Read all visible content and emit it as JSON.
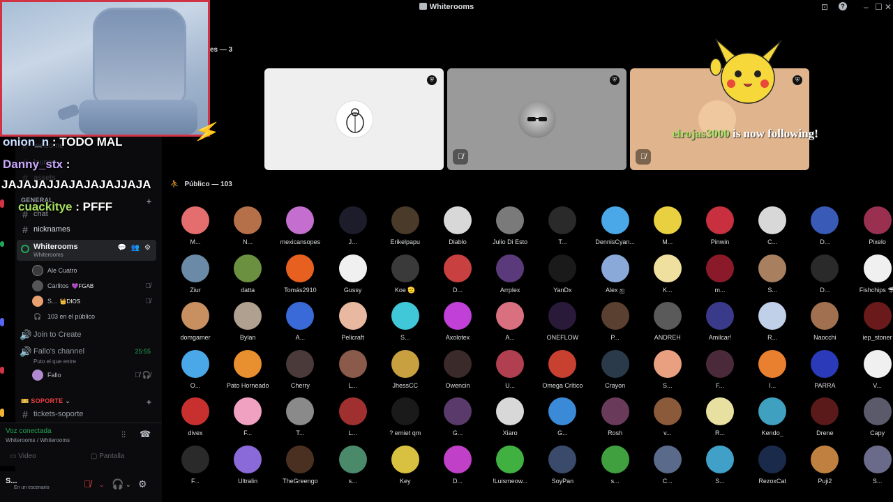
{
  "window": {
    "title": "Whiterooms",
    "controls": [
      "⊡",
      "?",
      "–",
      "☐",
      "✕"
    ]
  },
  "stream": {
    "chat": [
      {
        "user": "onion_n",
        "sep": " : ",
        "text": "TODO MAL"
      },
      {
        "user": "Danny_stx",
        "sep": " :",
        "text": ""
      },
      {
        "user": "",
        "sep": "",
        "text": "JAJAJAJJAJAJAJAJJAJA"
      },
      {
        "user": "cuackitye",
        "sep": " : ",
        "text": "PFFF"
      }
    ],
    "follow_alert": {
      "name": "elrojas3000",
      "text": " is now following!"
    }
  },
  "sidebar": {
    "faded_rows": [
      "welcome",
      "lounge",
      "assets"
    ],
    "category_general": "GENERAL",
    "chat_channel": "chat",
    "nicknames_channel": "nicknames",
    "voice_channel": {
      "name": "Whiterooms",
      "subtitle": "Whiterooms",
      "icons": "💬 👥 ⚙",
      "members": [
        {
          "name": "Ale Cuatro",
          "badge": "",
          "muted": false,
          "color": "#3a3a3a"
        },
        {
          "name": "Carlitos",
          "badge": "💜FGAB",
          "muted": true,
          "color": "#555"
        },
        {
          "name": "S...",
          "badge": "👑DIOS",
          "muted": true,
          "color": "#e8a070"
        }
      ],
      "audience_count": "103 en el público"
    },
    "join_to_create": "Join to Create",
    "fallo_channel": {
      "name": "Fallo's channel",
      "subtitle": "Puto el que entre",
      "timer": "25:55",
      "member": "Fallo"
    },
    "category_soporte": "🎫 SOPORTE",
    "tickets_channel": "tickets-soporte"
  },
  "voice_panel": {
    "status": "Voz conectada",
    "location": "Whiterooms / Whiterooms",
    "video_label": "Video",
    "screen_label": "Pantalla"
  },
  "user_panel": {
    "name": "S...",
    "status": "En un escenario"
  },
  "stage": {
    "speakers_label": "es — 3",
    "audience_label": "Público — 103",
    "speakers": [
      {
        "bg": "#efefef",
        "avatar": "#ffffff",
        "muted": false
      },
      {
        "bg": "#9a9a9a",
        "avatar": "#6e6e6e",
        "muted": true
      },
      {
        "bg": "#e0b48c",
        "avatar": "#f0c8a0",
        "muted": true
      }
    ]
  },
  "audience": [
    {
      "name": "M...",
      "color": "#e46d6d"
    },
    {
      "name": "N...",
      "color": "#b5704a"
    },
    {
      "name": "mexicansopes",
      "color": "#c46fd0"
    },
    {
      "name": "J...",
      "color": "#1c1c2a"
    },
    {
      "name": "Erikelpapu",
      "color": "#4a3a2a"
    },
    {
      "name": "Diablo",
      "color": "#d8d8d8"
    },
    {
      "name": "Julio Di Esto",
      "color": "#7a7a7a"
    },
    {
      "name": "T...",
      "color": "#2a2a2a"
    },
    {
      "name": "DennisCyan...",
      "color": "#4aa8e8"
    },
    {
      "name": "M...",
      "color": "#e8d040"
    },
    {
      "name": "Pinwin",
      "color": "#c83040"
    },
    {
      "name": "C...",
      "color": "#d8d8d8"
    },
    {
      "name": "D...",
      "color": "#3a5ab8"
    },
    {
      "name": "Pixelo",
      "color": "#9a3050"
    },
    {
      "name": "Ziur",
      "color": "#6a8aa8"
    },
    {
      "name": "datta",
      "color": "#6a9040"
    },
    {
      "name": "Tomás2910",
      "color": "#e86020"
    },
    {
      "name": "Gussy",
      "color": "#f0f0f0"
    },
    {
      "name": "Koe 🫡",
      "color": "#3a3a3a"
    },
    {
      "name": "D...",
      "color": "#c84040"
    },
    {
      "name": "Arrplex",
      "color": "#5a3a7a"
    },
    {
      "name": "YanDx",
      "color": "#1a1a1a"
    },
    {
      "name": "Alex ஐ",
      "color": "#8aa8d8"
    },
    {
      "name": "K...",
      "color": "#f0e0a0"
    },
    {
      "name": "m...",
      "color": "#8a1a2a"
    },
    {
      "name": "S...",
      "color": "#a88060"
    },
    {
      "name": "D...",
      "color": "#2a2a2a"
    },
    {
      "name": "Fishchips 🦈",
      "color": "#f0f0f0"
    },
    {
      "name": "domgamer",
      "color": "#c89060"
    },
    {
      "name": "Bylan",
      "color": "#b0a090"
    },
    {
      "name": "A...",
      "color": "#3a6ad8"
    },
    {
      "name": "Pelicraft",
      "color": "#e8b8a0"
    },
    {
      "name": "S...",
      "color": "#40c8d8"
    },
    {
      "name": "Axolotex",
      "color": "#c040d8"
    },
    {
      "name": "A...",
      "color": "#d87080"
    },
    {
      "name": "ONEFLOW",
      "color": "#2a1a3a"
    },
    {
      "name": "P...",
      "color": "#5a4030"
    },
    {
      "name": "ANDREH",
      "color": "#5a5a5a"
    },
    {
      "name": "Amilcar!",
      "color": "#3a3a8a"
    },
    {
      "name": "R...",
      "color": "#c0d0e8"
    },
    {
      "name": "Naocchi",
      "color": "#a07050"
    },
    {
      "name": "iep_stoner",
      "color": "#6a1a1a"
    },
    {
      "name": "O...",
      "color": "#4aa8e8"
    },
    {
      "name": "Pato Horneado",
      "color": "#e89030"
    },
    {
      "name": "Cherry",
      "color": "#4a3a3a"
    },
    {
      "name": "L...",
      "color": "#8a5a4a"
    },
    {
      "name": "JhessCC",
      "color": "#c8a040"
    },
    {
      "name": "Owencin",
      "color": "#3a2a2a"
    },
    {
      "name": "U...",
      "color": "#b04050"
    },
    {
      "name": "Omega Crítico",
      "color": "#c84030"
    },
    {
      "name": "Crayon",
      "color": "#2a3a4a"
    },
    {
      "name": "S...",
      "color": "#e8a080"
    },
    {
      "name": "F...",
      "color": "#4a2a3a"
    },
    {
      "name": "I...",
      "color": "#e88030"
    },
    {
      "name": "PARRA",
      "color": "#2a3ab8"
    },
    {
      "name": "V...",
      "color": "#f0f0f0"
    },
    {
      "name": "divex",
      "color": "#c83030"
    },
    {
      "name": "F...",
      "color": "#f0a0c0"
    },
    {
      "name": "T...",
      "color": "#8a8a8a"
    },
    {
      "name": "L...",
      "color": "#a03030"
    },
    {
      "name": "? erniet qm",
      "color": "#1a1a1a"
    },
    {
      "name": "G...",
      "color": "#5a3a6a"
    },
    {
      "name": "Xiaro",
      "color": "#d8d8d8"
    },
    {
      "name": "G...",
      "color": "#3a8ad8"
    },
    {
      "name": "Rosh",
      "color": "#6a3a5a"
    },
    {
      "name": "v...",
      "color": "#8a5a3a"
    },
    {
      "name": "R...",
      "color": "#e8e0a0"
    },
    {
      "name": "Kendo_",
      "color": "#40a0c0"
    },
    {
      "name": "Drene",
      "color": "#5a1a1a"
    },
    {
      "name": "Capy",
      "color": "#5a5a6a"
    },
    {
      "name": "F...",
      "color": "#2a2a2a"
    },
    {
      "name": "Ultralin",
      "color": "#8a6ad8"
    },
    {
      "name": "TheGreengo",
      "color": "#4a3020"
    },
    {
      "name": "s...",
      "color": "#4a8a6a"
    },
    {
      "name": "Key",
      "color": "#d8c040"
    },
    {
      "name": "D...",
      "color": "#c040c8"
    },
    {
      "name": "!Luismeow...",
      "color": "#40b040"
    },
    {
      "name": "SoyPan",
      "color": "#3a4a6a"
    },
    {
      "name": "s...",
      "color": "#40a040"
    },
    {
      "name": "C...",
      "color": "#5a6a8a"
    },
    {
      "name": "S...",
      "color": "#40a0c8"
    },
    {
      "name": "RezoxCat",
      "color": "#1a2a4a"
    },
    {
      "name": "Puji2",
      "color": "#c08040"
    },
    {
      "name": "S...",
      "color": "#6a6a8a"
    }
  ]
}
